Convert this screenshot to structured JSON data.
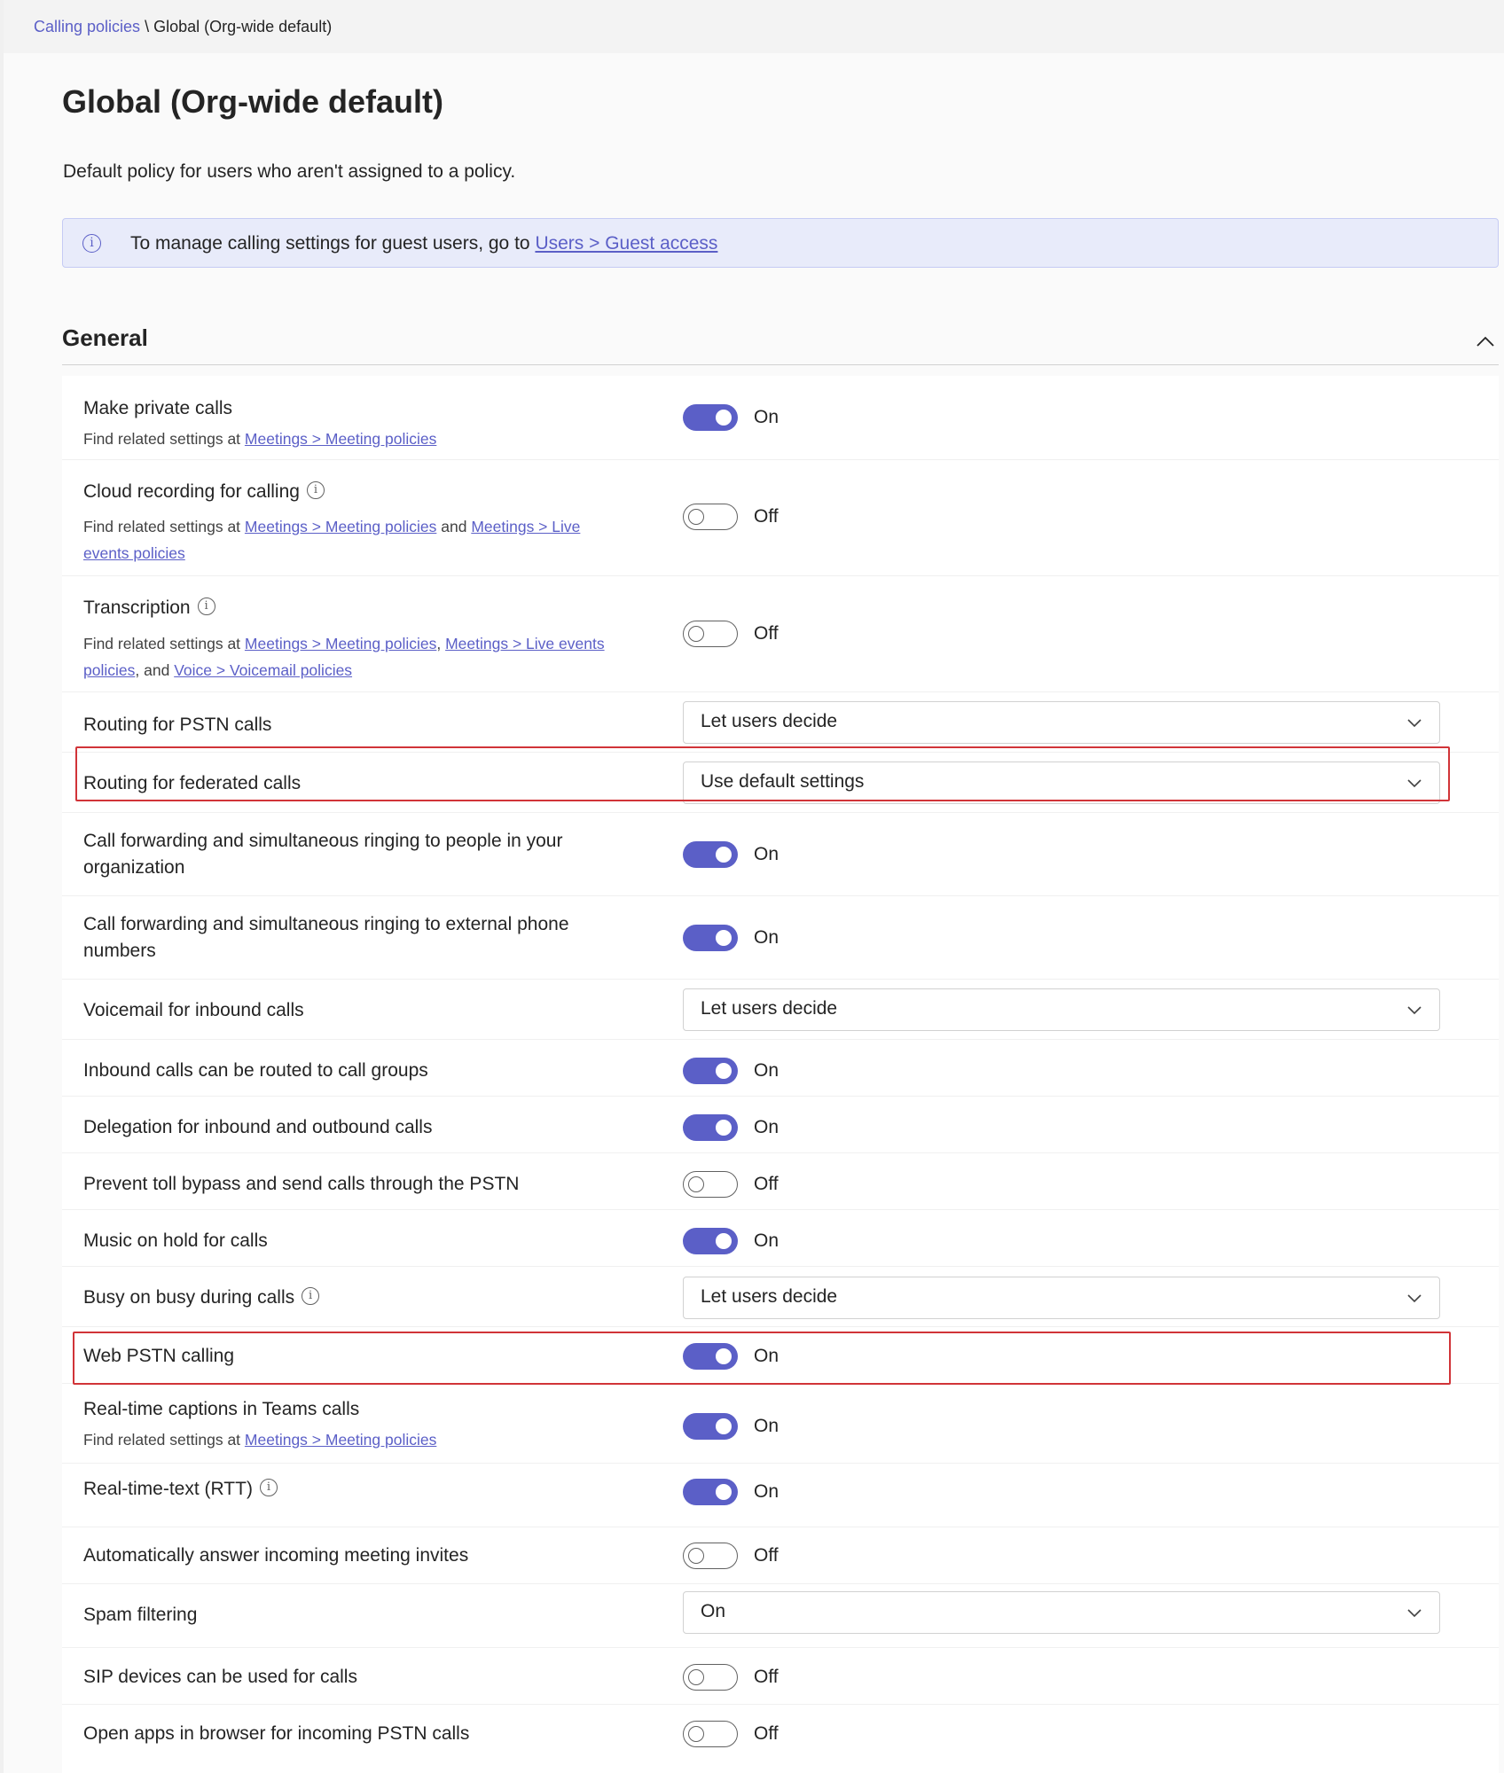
{
  "breadcrumb": {
    "parent": "Calling policies",
    "separator": "\\",
    "current": "Global (Org-wide default)"
  },
  "page": {
    "title": "Global (Org-wide default)",
    "description": "Default policy for users who aren't assigned to a policy."
  },
  "banner": {
    "text": "To manage calling settings for guest users, go to",
    "link": "Users > Guest access"
  },
  "section": {
    "title": "General"
  },
  "common": {
    "find_related": "Find related settings at",
    "and": "and",
    "comma": ",",
    "comma_and": ", and"
  },
  "links": {
    "meeting_policies": "Meetings > Meeting policies",
    "live_events_1": "Meetings > Live",
    "live_events_2": "events policies",
    "live_events_a": "Meetings > Live events",
    "live_events_b": "policies",
    "voicemail": "Voice > Voicemail policies"
  },
  "settings": {
    "private_calls": {
      "label": "Make private calls",
      "state": "On"
    },
    "cloud_recording": {
      "label": "Cloud recording for calling",
      "state": "Off"
    },
    "transcription": {
      "label": "Transcription",
      "state": "Off"
    },
    "routing_pstn": {
      "label": "Routing for PSTN calls",
      "value": "Let users decide"
    },
    "routing_federated": {
      "label": "Routing for federated calls",
      "value": "Use default settings"
    },
    "fwd_internal": {
      "label_1": "Call forwarding and simultaneous ringing to people in your",
      "label_2": "organization",
      "state": "On"
    },
    "fwd_external": {
      "label_1": "Call forwarding and simultaneous ringing to external phone",
      "label_2": "numbers",
      "state": "On"
    },
    "voicemail_inbound": {
      "label": "Voicemail for inbound calls",
      "value": "Let users decide"
    },
    "call_groups": {
      "label": "Inbound calls can be routed to call groups",
      "state": "On"
    },
    "delegation": {
      "label": "Delegation for inbound and outbound calls",
      "state": "On"
    },
    "toll_bypass": {
      "label": "Prevent toll bypass and send calls through the PSTN",
      "state": "Off"
    },
    "music_hold": {
      "label": "Music on hold for calls",
      "state": "On"
    },
    "busy_on_busy": {
      "label": "Busy on busy during calls",
      "value": "Let users decide"
    },
    "web_pstn": {
      "label": "Web PSTN calling",
      "state": "On"
    },
    "captions": {
      "label": "Real-time captions in Teams calls",
      "state": "On"
    },
    "rtt": {
      "label": "Real-time-text (RTT)",
      "state": "On"
    },
    "auto_answer": {
      "label": "Automatically answer incoming meeting invites",
      "state": "Off"
    },
    "spam": {
      "label": "Spam filtering",
      "value": "On"
    },
    "sip_devices": {
      "label": "SIP devices can be used for calls",
      "state": "Off"
    },
    "open_apps": {
      "label": "Open apps in browser for incoming PSTN calls",
      "state": "Off"
    }
  },
  "colors": {
    "accent": "#5b5fc7",
    "highlight": "#d13438",
    "banner_bg": "#e8ebfa"
  },
  "icons": {
    "info": "info-icon",
    "collapse": "chevron-up-icon",
    "dropdown": "chevron-down-icon"
  }
}
